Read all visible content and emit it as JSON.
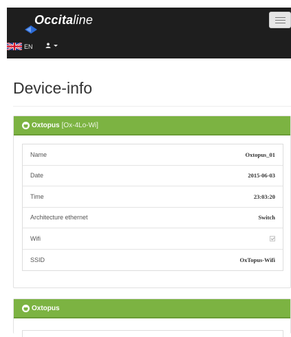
{
  "header": {
    "brand_prefix": "Occita",
    "brand_suffix": "line",
    "language": "EN"
  },
  "page": {
    "title": "Device-info"
  },
  "panels": [
    {
      "title": "Oxtopus",
      "subtitle": "[Ox-4Lo-Wi]",
      "rows": [
        {
          "label": "Name",
          "value": "Oxtopus_01"
        },
        {
          "label": "Date",
          "value": "2015-06-03"
        },
        {
          "label": "Time",
          "value": "23:03:20"
        },
        {
          "label": "Architecture ethernet",
          "value": "Switch"
        },
        {
          "label": "Wifi",
          "value": ""
        },
        {
          "label": "SSID",
          "value": "OxTopus-Wifi"
        }
      ]
    },
    {
      "title": "Oxtopus"
    }
  ],
  "colors": {
    "navbar": "#1e1e1e",
    "panel_header": "#7cb342"
  }
}
